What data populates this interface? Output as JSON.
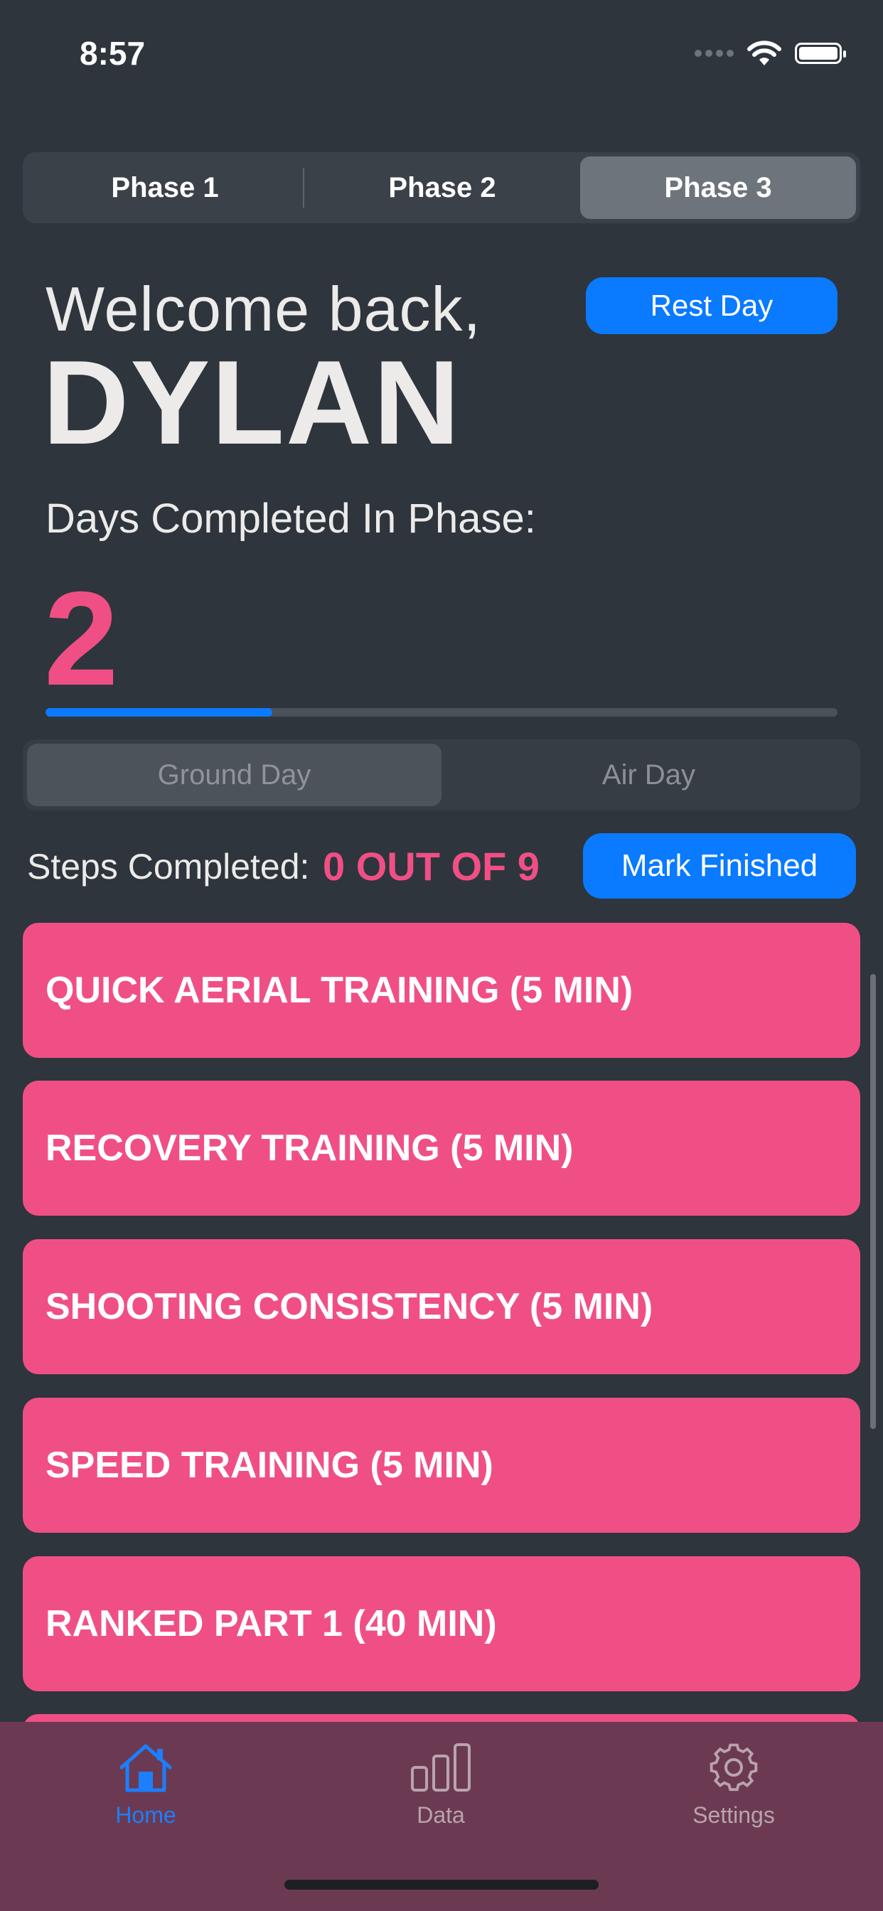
{
  "status_bar": {
    "time": "8:57"
  },
  "phase_tabs": [
    {
      "label": "Phase 1",
      "active": false
    },
    {
      "label": "Phase 2",
      "active": false
    },
    {
      "label": "Phase 3",
      "active": true
    }
  ],
  "welcome": {
    "greeting": "Welcome back,",
    "name": "DYLAN"
  },
  "rest_day_button": "Rest Day",
  "phase_progress": {
    "label": "Days Completed In Phase:",
    "days": "2",
    "fraction": 0.286
  },
  "day_tabs": [
    {
      "label": "Ground Day",
      "active": true
    },
    {
      "label": "Air Day",
      "active": false
    }
  ],
  "steps": {
    "label": "Steps Completed:",
    "value": "0 OUT OF 9",
    "mark_finished": "Mark Finished"
  },
  "training_items": [
    "QUICK AERIAL TRAINING (5 MIN)",
    "RECOVERY TRAINING (5 MIN)",
    "SHOOTING CONSISTENCY (5 MIN)",
    "SPEED TRAINING (5 MIN)",
    "RANKED PART 1 (40 MIN)"
  ],
  "tab_bar": [
    {
      "label": "Home",
      "icon": "house-icon",
      "active": true
    },
    {
      "label": "Data",
      "icon": "bar-chart-icon",
      "active": false
    },
    {
      "label": "Settings",
      "icon": "gear-icon",
      "active": false
    }
  ],
  "colors": {
    "background": "#2e353c",
    "accent_pink": "#f04f86",
    "accent_blue": "#0a7aff",
    "tab_bar": "#6b3a52"
  }
}
